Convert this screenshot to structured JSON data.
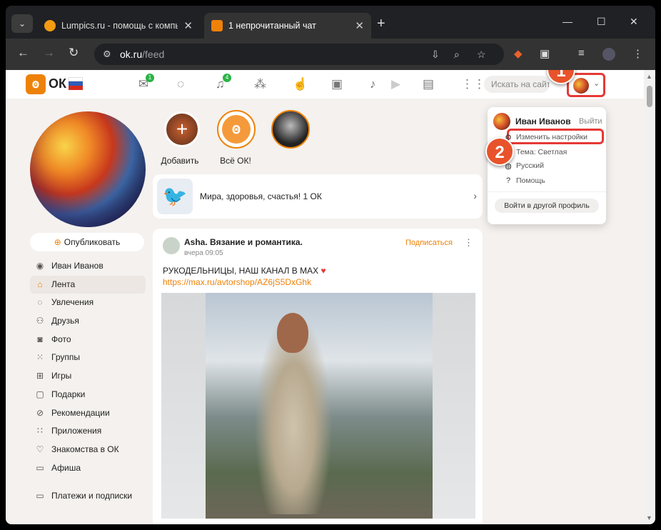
{
  "browser": {
    "tabs": [
      {
        "title": "Lumpics.ru - помощь с компь",
        "favicon_color": "#f39c12"
      },
      {
        "title": "1 непрочитанный чат",
        "favicon_color": "#ee8208"
      }
    ],
    "url_host": "ok.ru",
    "url_path": "/feed"
  },
  "header": {
    "logo_text": "ОК",
    "messages_badge": "1",
    "notifications_badge": "4",
    "search_placeholder": "Искать на сайт"
  },
  "steps": {
    "one": "1",
    "two": "2"
  },
  "stories": [
    {
      "label": "Добавить"
    },
    {
      "label": "Всё ОК!"
    }
  ],
  "profile": {
    "name": "Иван Иванов",
    "publish_label": "Опубликовать"
  },
  "sidebar": {
    "items": [
      {
        "label": "Иван Иванов",
        "icon": "user-icon"
      },
      {
        "label": "Лента",
        "icon": "home-icon"
      },
      {
        "label": "Увлечения",
        "icon": "hobby-icon"
      },
      {
        "label": "Друзья",
        "icon": "friends-icon"
      },
      {
        "label": "Фото",
        "icon": "camera-icon"
      },
      {
        "label": "Группы",
        "icon": "groups-icon"
      },
      {
        "label": "Игры",
        "icon": "gamepad-icon"
      },
      {
        "label": "Подарки",
        "icon": "gift-icon"
      },
      {
        "label": "Рекомендации",
        "icon": "compass-icon"
      },
      {
        "label": "Приложения",
        "icon": "apps-icon"
      },
      {
        "label": "Знакомства в ОК",
        "icon": "heart-icon"
      },
      {
        "label": "Афиша",
        "icon": "ticket-icon"
      }
    ],
    "payments_label": "Платежи и подписки"
  },
  "tweet_card": {
    "text": "Мира, здоровья, счастья! 1 ОК"
  },
  "post": {
    "author": "Asha. Вязание и романтика.",
    "time": "вчера 09:05",
    "subscribe_label": "Подписаться",
    "text": "РУКОДЕЛЬНИЦЫ,  НАШ КАНАЛ В МАХ",
    "link": "https://max.ru/avtorshop/AZ6jS5DxGhk"
  },
  "dropdown": {
    "name": "Иван Иванов",
    "logout": "Выйти",
    "items": [
      {
        "label": "Изменить настройки",
        "icon": "settings-icon"
      },
      {
        "label": "Тема: Светлая",
        "icon": "sun-icon"
      },
      {
        "label": "Русский",
        "icon": "globe-icon"
      },
      {
        "label": "Помощь",
        "icon": "help-icon"
      }
    ],
    "switch_profile": "Войти в другой профиль"
  },
  "colors": {
    "accent": "#ee8208",
    "highlight": "#e53935",
    "badge": "#2cb347"
  }
}
